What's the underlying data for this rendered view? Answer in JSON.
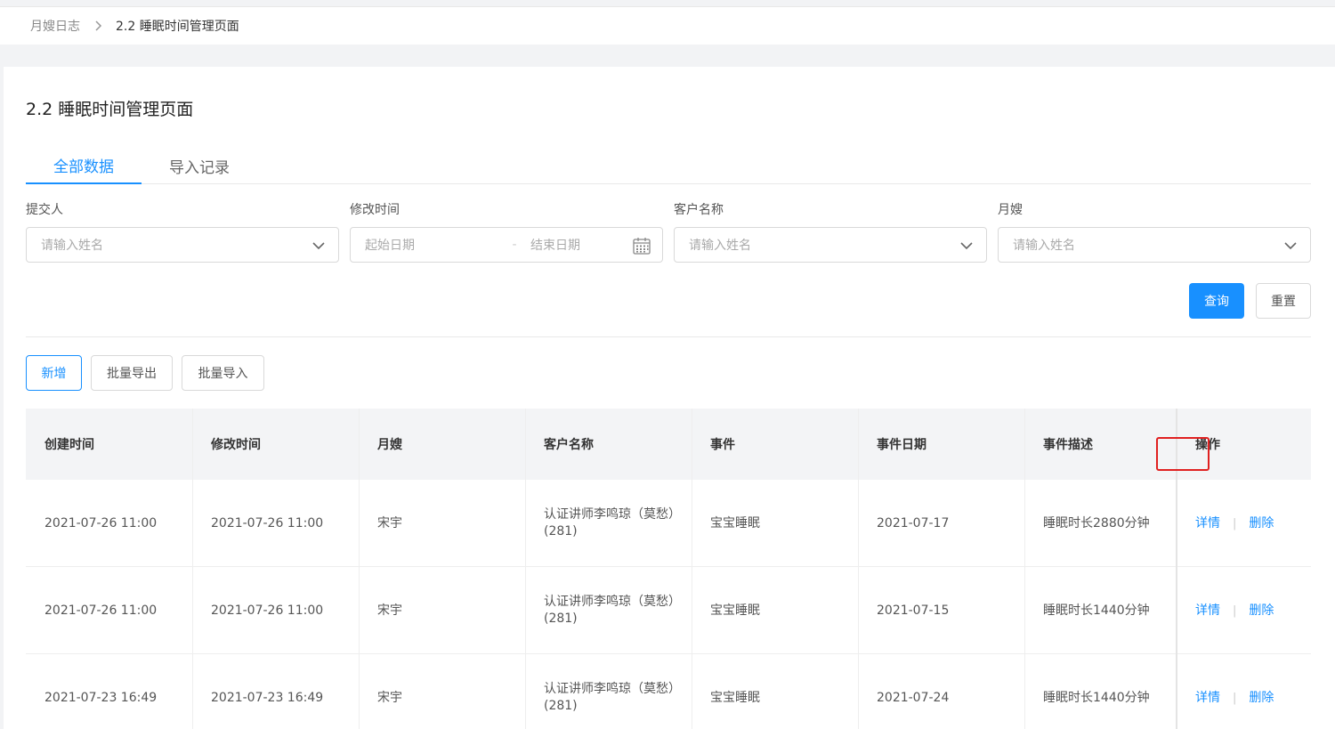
{
  "breadcrumb": {
    "root": "月嫂日志",
    "current": "2.2 睡眠时间管理页面"
  },
  "page_title": "2.2 睡眠时间管理页面",
  "tabs": [
    {
      "label": "全部数据",
      "active": true
    },
    {
      "label": "导入记录",
      "active": false
    }
  ],
  "filters": {
    "submitter": {
      "label": "提交人",
      "placeholder": "请输入姓名"
    },
    "modified_time": {
      "label": "修改时间",
      "start_placeholder": "起始日期",
      "separator": "-",
      "end_placeholder": "结束日期"
    },
    "customer": {
      "label": "客户名称",
      "placeholder": "请输入姓名"
    },
    "nanny": {
      "label": "月嫂",
      "placeholder": "请输入姓名"
    }
  },
  "buttons": {
    "query": "查询",
    "reset": "重置",
    "add": "新增",
    "batch_export": "批量导出",
    "batch_import": "批量导入"
  },
  "table": {
    "headers": [
      "创建时间",
      "修改时间",
      "月嫂",
      "客户名称",
      "事件",
      "事件日期",
      "事件描述",
      "操作"
    ],
    "rows": [
      {
        "created": "2021-07-26 11:00",
        "modified": "2021-07-26 11:00",
        "nanny": "宋宇",
        "customer": "认证讲师李鸣琼（莫愁）(281)",
        "event": "宝宝睡眠",
        "event_date": "2021-07-17",
        "description": "睡眠时长2880分钟",
        "detail": "详情",
        "delete": "删除"
      },
      {
        "created": "2021-07-26 11:00",
        "modified": "2021-07-26 11:00",
        "nanny": "宋宇",
        "customer": "认证讲师李鸣琼（莫愁）(281)",
        "event": "宝宝睡眠",
        "event_date": "2021-07-15",
        "description": "睡眠时长1440分钟",
        "detail": "详情",
        "delete": "删除"
      },
      {
        "created": "2021-07-23 16:49",
        "modified": "2021-07-23 16:49",
        "nanny": "宋宇",
        "customer": "认证讲师李鸣琼（莫愁）(281)",
        "event": "宝宝睡眠",
        "event_date": "2021-07-24",
        "description": "睡眠时长1440分钟",
        "detail": "详情",
        "delete": "删除"
      }
    ]
  },
  "colors": {
    "primary": "#1890ff",
    "highlight": "#e02020",
    "header_bg": "#f3f4f6"
  },
  "icons": [
    "chevron-right-icon",
    "chevron-down-icon",
    "calendar-icon"
  ]
}
